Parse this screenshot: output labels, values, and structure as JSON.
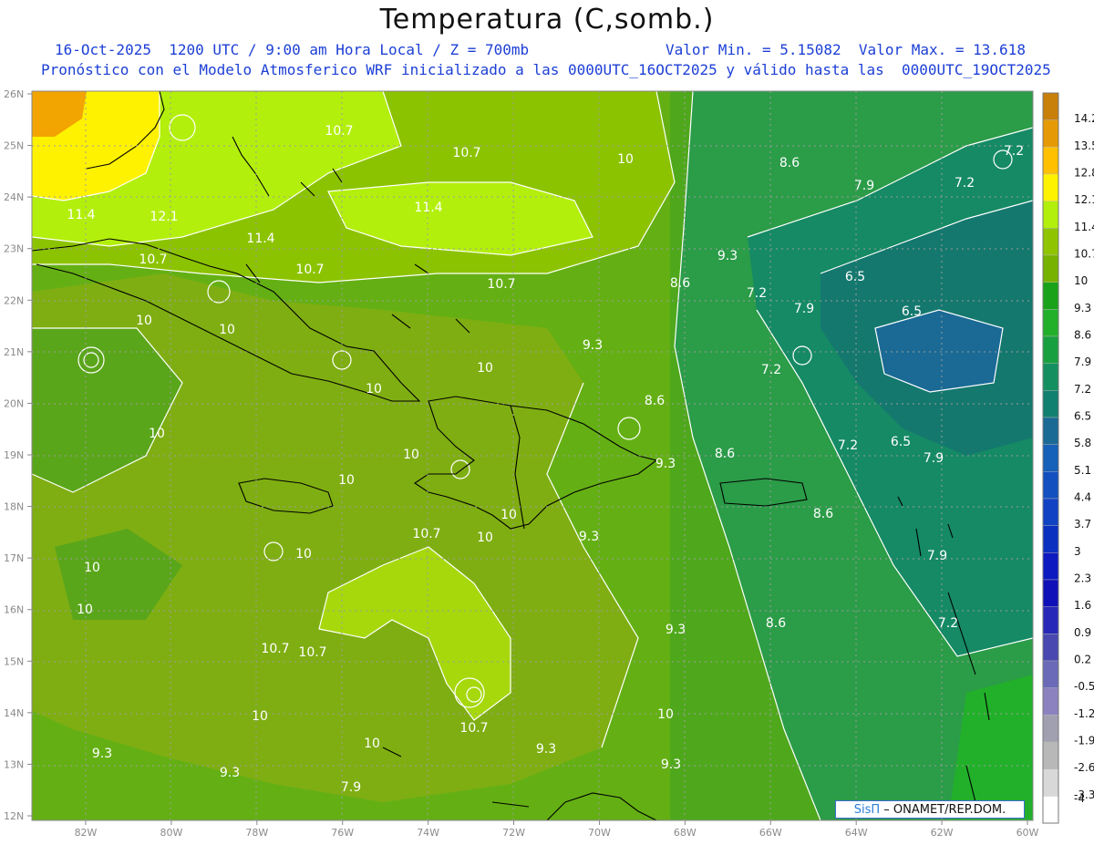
{
  "header": {
    "title": "Temperatura (C,somb.)",
    "line1_left": "16-Oct-2025  1200 UTC / 9:00 am Hora Local / Z = 700mb",
    "line1_right": "Valor Min. = 5.15082  Valor Max. = 13.618",
    "line2": "Pronóstico con el Modelo Atmosferico WRF inicializado a las 0000UTC_16OCT2025 y válido hasta las  0000UTC_19OCT2025"
  },
  "axes": {
    "lat_labels": [
      "26N",
      "25N",
      "24N",
      "23N",
      "22N",
      "21N",
      "20N",
      "19N",
      "18N",
      "17N",
      "16N",
      "15N",
      "14N",
      "13N",
      "12N"
    ],
    "lon_labels": [
      "82W",
      "80W",
      "78W",
      "76W",
      "74W",
      "72W",
      "70W",
      "68W",
      "66W",
      "64W",
      "62W",
      "60W"
    ]
  },
  "colorbar": {
    "labels": [
      "14.2",
      "13.5",
      "12.8",
      "12.1",
      "11.4",
      "10.7",
      "10",
      "9.3",
      "8.6",
      "7.9",
      "7.2",
      "6.5",
      "5.8",
      "5.1",
      "4.4",
      "3.7",
      "3",
      "2.3",
      "1.6",
      "0.9",
      "0.2",
      "-0.5",
      "-1.2",
      "-1.9",
      "-2.6",
      "-3.3",
      "-4"
    ],
    "colors": [
      "#c8800a",
      "#e59a05",
      "#ffc000",
      "#fff200",
      "#b2ef0c",
      "#8ec500",
      "#78b200",
      "#1aa31a",
      "#22b02a",
      "#18a040",
      "#149060",
      "#128070",
      "#1a6a95",
      "#1560b8",
      "#1250c0",
      "#1242c4",
      "#0a30c0",
      "#0c1ac0",
      "#1010b8",
      "#2828b8",
      "#4848b0",
      "#6a6ab8",
      "#8c82c0",
      "#a0a0b0",
      "#b8b8b8",
      "#d8d8d8",
      "#ffffff"
    ]
  },
  "contour_labels": [
    {
      "text": "10.7"
    },
    {
      "text": "10.7"
    },
    {
      "text": "10"
    },
    {
      "text": "8.6"
    },
    {
      "text": "7.2"
    },
    {
      "text": "7.9"
    },
    {
      "text": "7.2"
    },
    {
      "text": "11.4"
    },
    {
      "text": "12.1"
    },
    {
      "text": "11.4"
    },
    {
      "text": "11.4"
    },
    {
      "text": "10.7"
    },
    {
      "text": "10.7"
    },
    {
      "text": "10.7"
    },
    {
      "text": "9.3"
    },
    {
      "text": "8.6"
    },
    {
      "text": "7.2"
    },
    {
      "text": "6.5"
    },
    {
      "text": "6.5"
    },
    {
      "text": "10"
    },
    {
      "text": "10"
    },
    {
      "text": "9.3"
    },
    {
      "text": "7.9"
    },
    {
      "text": "10"
    },
    {
      "text": "10"
    },
    {
      "text": "7.2"
    },
    {
      "text": "10"
    },
    {
      "text": "8.6"
    },
    {
      "text": "10"
    },
    {
      "text": "10"
    },
    {
      "text": "9.3"
    },
    {
      "text": "8.6"
    },
    {
      "text": "7.2"
    },
    {
      "text": "6.5"
    },
    {
      "text": "7.9"
    },
    {
      "text": "10"
    },
    {
      "text": "10.7"
    },
    {
      "text": "10"
    },
    {
      "text": "9.3"
    },
    {
      "text": "8.6"
    },
    {
      "text": "10"
    },
    {
      "text": "10"
    },
    {
      "text": "7.9"
    },
    {
      "text": "10"
    },
    {
      "text": "9.3"
    },
    {
      "text": "8.6"
    },
    {
      "text": "7.2"
    },
    {
      "text": "10.7"
    },
    {
      "text": "10.7"
    },
    {
      "text": "10.7"
    },
    {
      "text": "10"
    },
    {
      "text": "10"
    },
    {
      "text": "9.3"
    },
    {
      "text": "10"
    },
    {
      "text": "9.3"
    },
    {
      "text": "9.3"
    },
    {
      "text": "9.3"
    },
    {
      "text": "7.9"
    }
  ],
  "credit": {
    "brand": "SisΠ",
    "text": "– ONAMET/REP.DOM."
  }
}
